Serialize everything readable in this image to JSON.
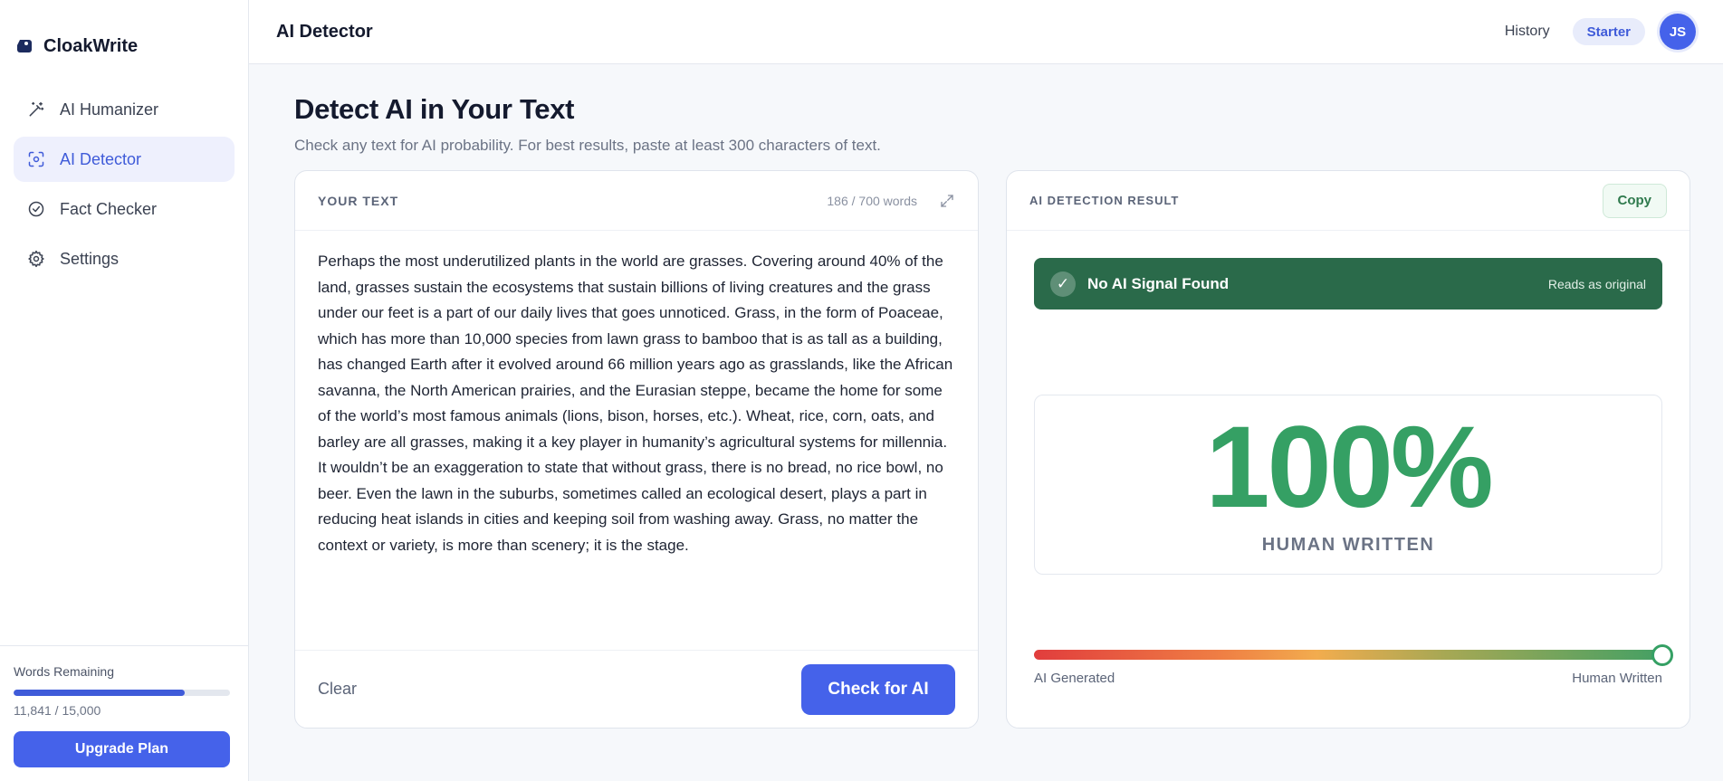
{
  "sidebar": {
    "brand": "CloakWrite",
    "items": [
      {
        "label": "AI Humanizer",
        "icon": "magic-wand-icon",
        "active": false
      },
      {
        "label": "AI Detector",
        "icon": "scan-face-icon",
        "active": true
      },
      {
        "label": "Fact Checker",
        "icon": "check-circle-icon",
        "active": false
      },
      {
        "label": "Settings",
        "icon": "gear-icon",
        "active": false
      }
    ],
    "words_label": "Words Remaining",
    "words_count": "11,841 / 15,000",
    "words_used_fraction": 0.789,
    "upgrade_label": "Upgrade Plan"
  },
  "topbar": {
    "title": "AI Detector",
    "history": "History",
    "plan": "Starter",
    "avatar": "JS"
  },
  "page": {
    "title": "Detect AI in Your Text",
    "subtitle": "Check any text for AI probability. For best results, paste at least 300 characters of text."
  },
  "input_panel": {
    "label": "YOUR TEXT",
    "word_count": "186 / 700 words",
    "text": "Perhaps the most underutilized plants in the world are grasses. Covering around 40% of the land, grasses sustain the ecosystems that sustain billions of living creatures and the grass under our feet is a part of our daily lives that goes unnoticed. Grass, in the form of Poaceae, which has more than 10,000 species from lawn grass to bamboo that is as tall as a building, has changed Earth after it evolved around 66 million years ago as grasslands, like the African savanna, the North American prairies, and the Eurasian steppe, became the home for some of the world’s most famous animals (lions, bison, horses, etc.). Wheat, rice, corn, oats, and barley are all grasses, making it a key player in humanity’s agricultural systems for millennia. It wouldn’t be an exaggeration to state that without grass, there is no bread, no rice bowl, no beer. Even the lawn in the suburbs, sometimes called an ecological desert, plays a part in reducing heat islands in cities and keeping soil from washing away. Grass, no matter the context or variety, is more than scenery; it is the stage.",
    "clear_label": "Clear",
    "check_label": "Check for AI"
  },
  "result_panel": {
    "label": "AI DETECTION RESULT",
    "copy_label": "Copy",
    "banner_title": "No AI Signal Found",
    "banner_note": "Reads as original",
    "score": "100%",
    "score_label": "HUMAN WRITTEN",
    "gauge_value": 1.0,
    "gauge_left": "AI Generated",
    "gauge_right": "Human Written"
  },
  "colors": {
    "accent": "#4562ea",
    "success": "#35a064",
    "banner": "#2a6a4a"
  }
}
